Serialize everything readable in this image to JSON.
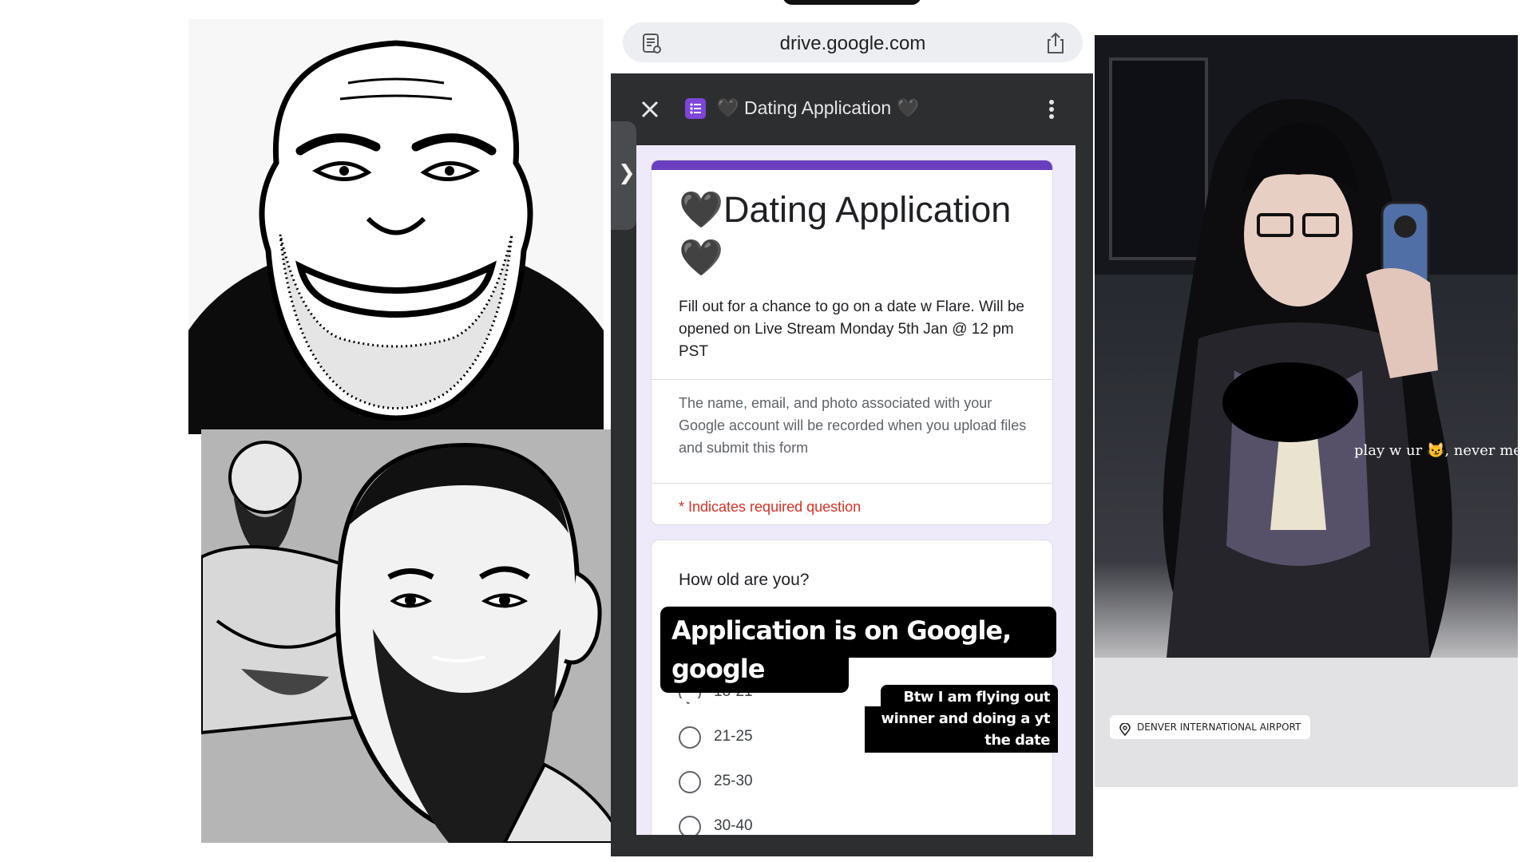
{
  "browser": {
    "url": "drive.google.com"
  },
  "form": {
    "header_title": "🖤 Dating Application 🖤",
    "title": "🖤Dating Application 🖤",
    "description": "Fill out for a chance to go on a date w Flare. Will be opened on Live Stream Monday 5th Jan @ 12 pm PST",
    "account_notice": "The name, email, and photo associated with your Google account will be recorded when you upload files and submit this form",
    "required_note": "* Indicates required question",
    "question": "How old are you?",
    "options": [
      "18-21",
      "21-25",
      "25-30",
      "30-40"
    ]
  },
  "overlays": {
    "main_line1": "Application is on Google, so u need to",
    "main_line2": "google account.",
    "small_line1": "Btw I am flying out the",
    "small_line2": "winner and doing a yt vid of",
    "small_line3": "the date"
  },
  "story": {
    "caption": "play w ur 😼, never me",
    "location": "DENVER INTERNATIONAL AIRPORT"
  },
  "colors": {
    "form_accent": "#6a3fbf",
    "required_red": "#d93025",
    "dark_ui": "#2d2e30",
    "form_background": "#efeafa"
  }
}
